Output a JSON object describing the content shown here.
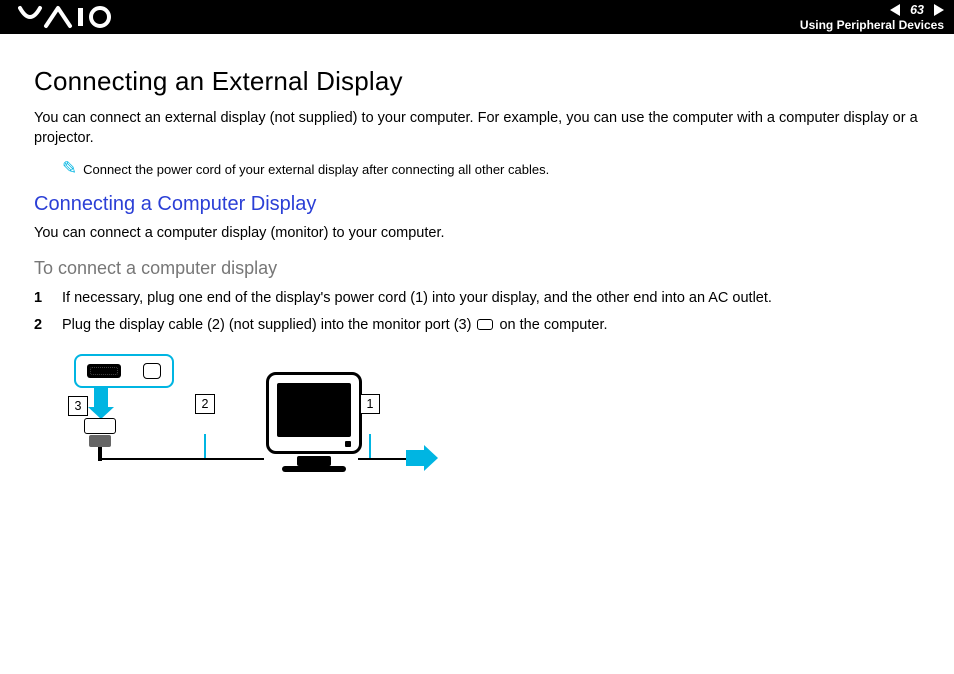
{
  "header": {
    "page_number": "63",
    "section": "Using Peripheral Devices"
  },
  "content": {
    "h1": "Connecting an External Display",
    "intro": "You can connect an external display (not supplied) to your computer. For example, you can use the computer with a computer display or a projector.",
    "note": "Connect the power cord of your external display after connecting all other cables.",
    "h2": "Connecting a Computer Display",
    "p2": "You can connect a computer display (monitor) to your computer.",
    "h3": "To connect a computer display",
    "steps": {
      "s1": "If necessary, plug one end of the display's power cord (1) into your display, and the other end into an AC outlet.",
      "s2a": "Plug the display cable (2) (not supplied) into the monitor port (3) ",
      "s2b": " on the computer."
    },
    "diagram": {
      "label1": "1",
      "label2": "2",
      "label3": "3"
    }
  }
}
